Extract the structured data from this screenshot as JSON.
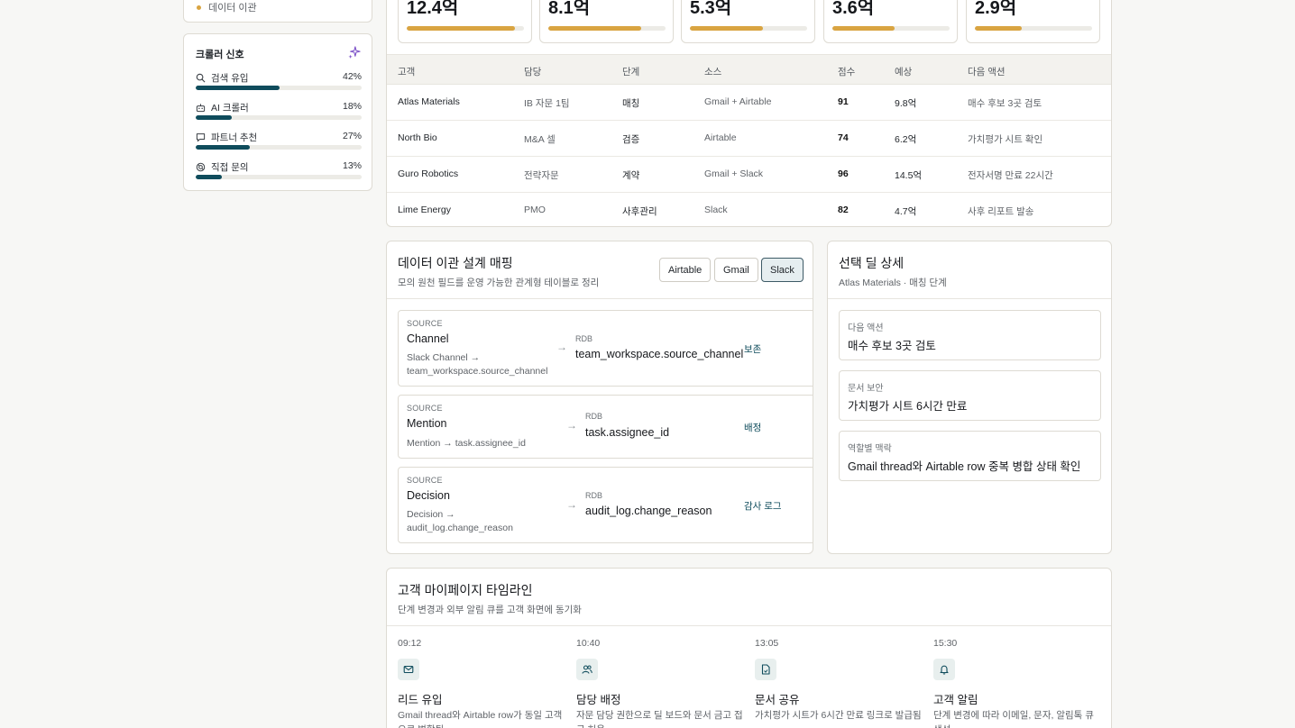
{
  "sidebar": {
    "nav_item": "데이터 이관",
    "signals": {
      "title": "크롤러 신호",
      "items": [
        {
          "label": "검색 유입",
          "percent": "42%",
          "value": 0.42,
          "icon": "search-icon"
        },
        {
          "label": "AI 크롤러",
          "percent": "18%",
          "value": 0.18,
          "icon": "robot-icon"
        },
        {
          "label": "파트너 추천",
          "percent": "27%",
          "value": 0.27,
          "icon": "message-icon"
        },
        {
          "label": "직접 문의",
          "percent": "13%",
          "value": 0.13,
          "icon": "support-icon"
        }
      ]
    }
  },
  "kpis": [
    {
      "value": "12.4억",
      "progress": 0.92
    },
    {
      "value": "8.1억",
      "progress": 0.79
    },
    {
      "value": "5.3억",
      "progress": 0.62
    },
    {
      "value": "3.6억",
      "progress": 0.53
    },
    {
      "value": "2.9억",
      "progress": 0.4
    }
  ],
  "deals_table": {
    "headers": [
      "고객",
      "담당",
      "단계",
      "소스",
      "점수",
      "예상",
      "다음 액션"
    ],
    "rows": [
      {
        "customer": "Atlas Materials",
        "owner": "IB 자문 1팀",
        "stage": "매칭",
        "source": "Gmail + Airtable",
        "score": "91",
        "estimate": "9.8억",
        "next_action": "매수 후보 3곳 검토"
      },
      {
        "customer": "North Bio",
        "owner": "M&A 셀",
        "stage": "검증",
        "source": "Airtable",
        "score": "74",
        "estimate": "6.2억",
        "next_action": "가치평가 시트 확인"
      },
      {
        "customer": "Guro Robotics",
        "owner": "전략자문",
        "stage": "계약",
        "source": "Gmail + Slack",
        "score": "96",
        "estimate": "14.5억",
        "next_action": "전자서명 만료 22시간"
      },
      {
        "customer": "Lime Energy",
        "owner": "PMO",
        "stage": "사후관리",
        "source": "Slack",
        "score": "82",
        "estimate": "4.7억",
        "next_action": "사후 리포트 발송"
      }
    ]
  },
  "mapping": {
    "title": "데이터 이관 설계 매핑",
    "subtitle": "모의 원천 필드를 운영 가능한 관계형 테이블로 정리",
    "tabs": [
      "Airtable",
      "Gmail",
      "Slack"
    ],
    "active_tab": "Slack",
    "cards": [
      {
        "source_tag": "SOURCE",
        "source": "Channel",
        "desc": "Slack Channel →\nteam_workspace.source_channel",
        "rdb_tag": "RDB",
        "target": "team_workspace.source_channel",
        "policy": "보존"
      },
      {
        "source_tag": "SOURCE",
        "source": "Mention",
        "desc": "Mention → task.assignee_id",
        "rdb_tag": "RDB",
        "target": "task.assignee_id",
        "policy": "배정"
      },
      {
        "source_tag": "SOURCE",
        "source": "Decision",
        "desc": "Decision →\naudit_log.change_reason",
        "rdb_tag": "RDB",
        "target": "audit_log.change_reason",
        "policy": "감사 로그"
      }
    ]
  },
  "deal_detail": {
    "title": "선택 딜 상세",
    "subtitle": "Atlas Materials · 매칭 단계",
    "fields": [
      {
        "label": "다음 액션",
        "value": "매수 후보 3곳 검토"
      },
      {
        "label": "문서 보안",
        "value": "가치평가 시트 6시간 만료"
      },
      {
        "label": "역할별 맥락",
        "value": "Gmail thread와 Airtable row 중복 병합 상태 확인"
      }
    ]
  },
  "timeline": {
    "title": "고객 마이페이지 타임라인",
    "subtitle": "단계 변경과 외부 알림 큐를 고객 화면에 동기화",
    "events": [
      {
        "time": "09:12",
        "icon": "mail-icon",
        "title": "리드 유입",
        "desc": "Gmail thread와 Airtable row가 동일 고객으로 병합됨"
      },
      {
        "time": "10:40",
        "icon": "users-icon",
        "title": "담당 배정",
        "desc": "자문 담당 권한으로 딜 보드와 문서 금고 접근 허용"
      },
      {
        "time": "13:05",
        "icon": "document-icon",
        "title": "문서 공유",
        "desc": "가치평가 시트가 6시간 만료 링크로 발급됨"
      },
      {
        "time": "15:30",
        "icon": "bell-icon",
        "title": "고객 알림",
        "desc": "단계 변경에 따라 이메일, 문자, 알림톡 큐 생성"
      }
    ]
  },
  "colors": {
    "accent": "#0f4c5c",
    "kpi_bar": "#d9a441",
    "nav_dot": "#d9a441",
    "spark_icon": "#7b4fc7"
  }
}
